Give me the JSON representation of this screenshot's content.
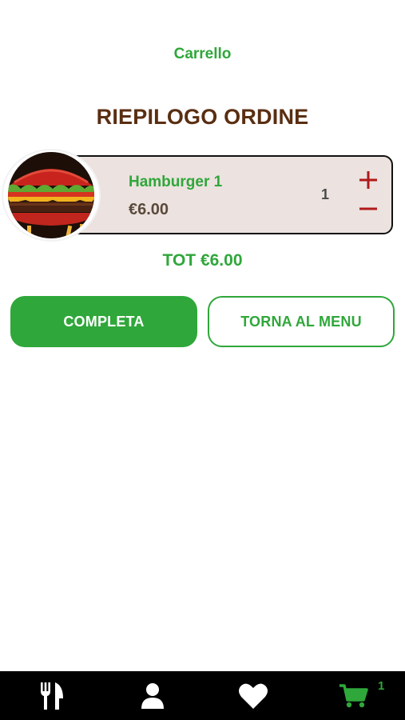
{
  "header": {
    "title": "Carrello"
  },
  "summary": {
    "title": "RIEPILOGO ORDINE"
  },
  "cart": {
    "items": [
      {
        "name": "Hamburger 1",
        "price": "€6.00",
        "quantity": "1",
        "image": "hamburger-photo"
      }
    ],
    "total_label": "TOT €6.00"
  },
  "actions": {
    "complete_label": "COMPLETA",
    "back_label": "TORNA AL MENU"
  },
  "tabbar": {
    "items": [
      {
        "icon": "fork-knife-icon",
        "active": false
      },
      {
        "icon": "user-icon",
        "active": false
      },
      {
        "icon": "heart-icon",
        "active": false
      },
      {
        "icon": "cart-icon",
        "active": true,
        "badge": "1"
      }
    ]
  },
  "colors": {
    "accent": "#2fa73a",
    "title_brown": "#5a2e12",
    "card_bg": "#ece2df",
    "qty_button": "#b01a1a",
    "tabbar_bg": "#000000"
  }
}
